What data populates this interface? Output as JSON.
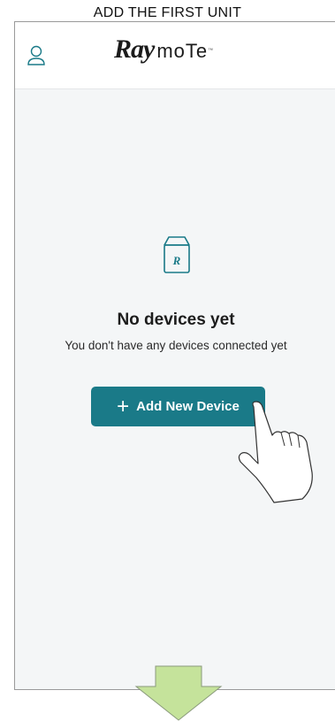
{
  "caption": "ADD THE FIRST UNIT",
  "header": {
    "profile_icon": "user-icon",
    "logo": {
      "brand_part1": "Ray",
      "brand_part2": "moTe",
      "trademark": "™"
    }
  },
  "empty_state": {
    "icon": "device-box-icon",
    "title": "No devices yet",
    "subtitle": "You don't have any devices connected yet",
    "add_button_label": "Add New Device",
    "add_button_icon": "plus-icon"
  },
  "colors": {
    "accent": "#1a7a88",
    "background": "#f4f6f7",
    "arrow_fill": "#c5e39b"
  }
}
